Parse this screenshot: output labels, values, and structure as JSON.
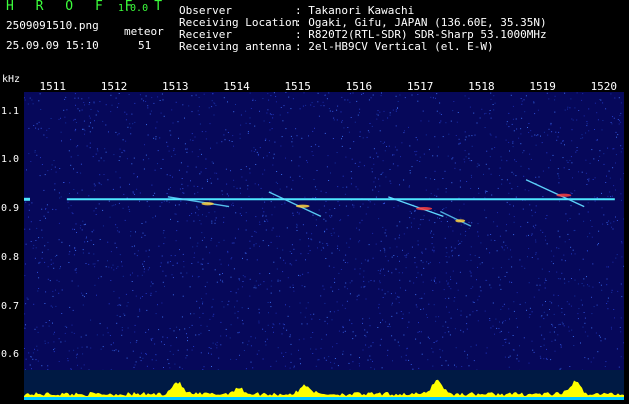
{
  "app": {
    "title": "H R O F F T",
    "version": "1.0.0"
  },
  "capture": {
    "filename": "2509091510.png",
    "timestamp": "25.09.09 15:10",
    "meteor_label": "meteor",
    "meteor_count": "51"
  },
  "info": [
    {
      "key": "Observer",
      "value": ": Takanori Kawachi"
    },
    {
      "key": "Receiving Location",
      "value": ": Ogaki, Gifu, JAPAN (136.60E, 35.35N)"
    },
    {
      "key": "Receiver",
      "value": ": R820T2(RTL-SDR) SDR-Sharp 53.1000MHz"
    },
    {
      "key": "Receiving antenna",
      "value": ": 2el-HB9CV Vertical (el. E-W)"
    }
  ],
  "axis": {
    "unit": "kHz",
    "time_ticks": [
      "1511",
      "1512",
      "1513",
      "1514",
      "1515",
      "1516",
      "1517",
      "1518",
      "1519",
      "1520"
    ],
    "freq_ticks": [
      "1.1",
      "1.0",
      "0.9",
      "0.8",
      "0.7",
      "0.6"
    ],
    "freq_range": [
      0.57,
      1.14
    ]
  },
  "colors": {
    "title_green": "#3cff3c",
    "background": "#06085a",
    "carrier": "#4fe7ff",
    "spectrum_fill": "#ffff00",
    "noise_floor": "#00c8ff"
  },
  "echoes": [
    {
      "t0": 1512.9,
      "t1": 1513.9,
      "f0": 0.925,
      "f1": 0.905,
      "intensity": 0.7
    },
    {
      "t0": 1514.55,
      "t1": 1515.4,
      "f0": 0.935,
      "f1": 0.885,
      "intensity": 0.8
    },
    {
      "t0": 1516.5,
      "t1": 1517.4,
      "f0": 0.925,
      "f1": 0.885,
      "intensity": 1.0
    },
    {
      "t0": 1517.35,
      "t1": 1517.85,
      "f0": 0.895,
      "f1": 0.865,
      "intensity": 0.5
    },
    {
      "t0": 1518.75,
      "t1": 1519.7,
      "f0": 0.96,
      "f1": 0.905,
      "intensity": 0.9
    }
  ],
  "carrier": {
    "freq": 0.92,
    "t_start": 1511.25,
    "t_end": 1520.2
  }
}
